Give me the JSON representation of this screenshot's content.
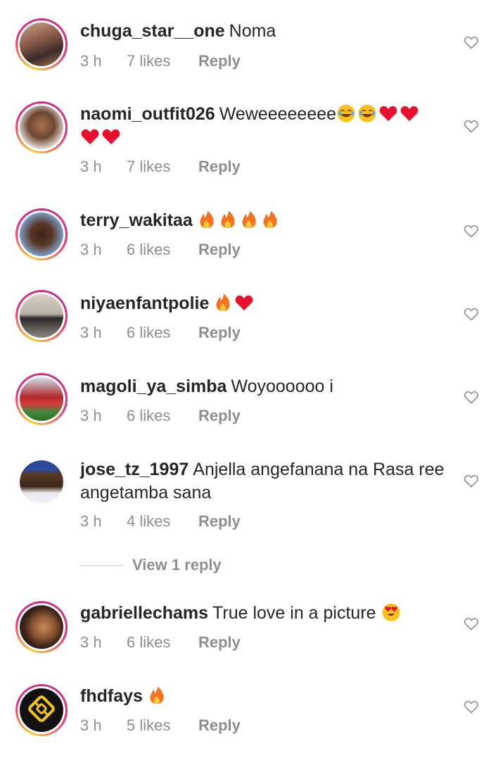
{
  "comments": [
    {
      "username": "chuga_star__one",
      "text": "Noma",
      "emojis": [],
      "time": "3 h",
      "likes": "7 likes",
      "reply": "Reply",
      "avatar": "story-ring"
    },
    {
      "username": "naomi_outfit026",
      "text": "Weweeeeeeee",
      "emojis": [
        "joy",
        "joy",
        "red-heart",
        "red-heart",
        "red-heart",
        "red-heart"
      ],
      "time": "3 h",
      "likes": "7 likes",
      "reply": "Reply",
      "avatar": "story-ring"
    },
    {
      "username": "terry_wakitaa",
      "text": "",
      "emojis": [
        "fire",
        "fire",
        "fire",
        "fire"
      ],
      "time": "3 h",
      "likes": "6 likes",
      "reply": "Reply",
      "avatar": "story-ring"
    },
    {
      "username": "niyaenfantpolie",
      "text": "",
      "emojis": [
        "fire",
        "red-heart"
      ],
      "time": "3 h",
      "likes": "6 likes",
      "reply": "Reply",
      "avatar": "story-ring"
    },
    {
      "username": "magoli_ya_simba",
      "text": "Woyoooooo i",
      "emojis": [],
      "time": "3 h",
      "likes": "6 likes",
      "reply": "Reply",
      "avatar": "story-ring"
    },
    {
      "username": "jose_tz_1997",
      "text": "Anjella angefanana na Rasa ree angetamba sana",
      "emojis": [],
      "time": "3 h",
      "likes": "4 likes",
      "reply": "Reply",
      "avatar": "plain"
    },
    {
      "username": "gabriellechams",
      "text": "True love in a picture",
      "emojis": [
        "heart-eyes"
      ],
      "time": "3 h",
      "likes": "6 likes",
      "reply": "Reply",
      "avatar": "story-ring"
    },
    {
      "username": "fhdfays",
      "text": "",
      "emojis": [
        "fire"
      ],
      "time": "3 h",
      "likes": "5 likes",
      "reply": "Reply",
      "avatar": "story-ring"
    }
  ],
  "view_replies": "View 1 reply",
  "colors": {
    "text": "#262626",
    "secondary": "#8e8e8e",
    "ring_start": "#f9ce34",
    "ring_mid": "#ee2a7b",
    "heart_red": "#e8112d",
    "fire_orange": "#f4731f"
  },
  "icons": {
    "like": "heart-outline-icon"
  }
}
